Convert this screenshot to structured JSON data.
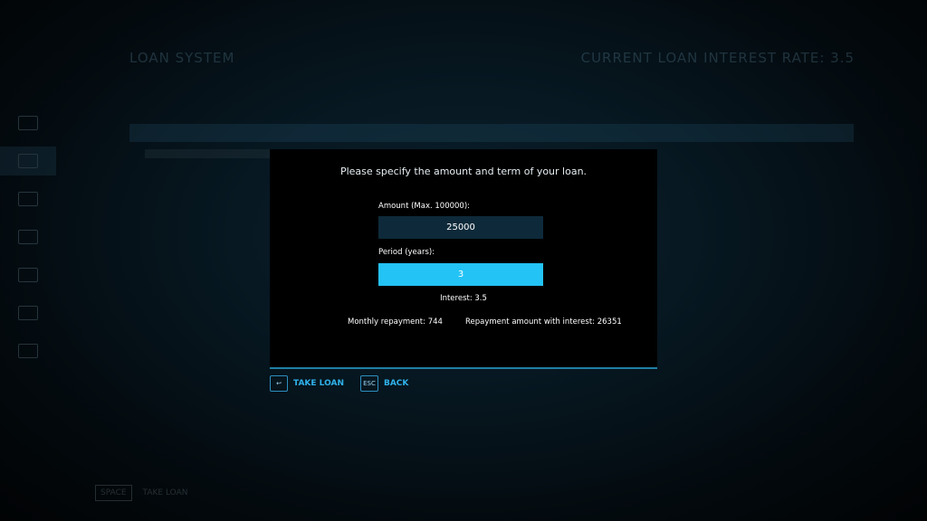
{
  "background": {
    "title": "LOAN SYSTEM",
    "rate": "CURRENT LOAN INTEREST RATE: 3.5",
    "footer_key": "SPACE",
    "footer_action": "TAKE LOAN"
  },
  "dialog": {
    "prompt": "Please specify the amount and term of your loan.",
    "amount_label": "Amount (Max. 100000):",
    "amount_value": "25000",
    "period_label": "Period (years):",
    "period_value": "3",
    "interest": "Interest: 3.5",
    "monthly": "Monthly repayment: 744",
    "repayment": "Repayment amount with interest: 26351"
  },
  "actions": {
    "take_key": "↩",
    "take_label": "TAKE LOAN",
    "back_key": "ESC",
    "back_label": "BACK"
  },
  "icons": [
    "enter-key-icon"
  ],
  "colors": {
    "accent": "#23c3f5",
    "field": "#0e2a3a",
    "divider": "#1f7fa6"
  }
}
